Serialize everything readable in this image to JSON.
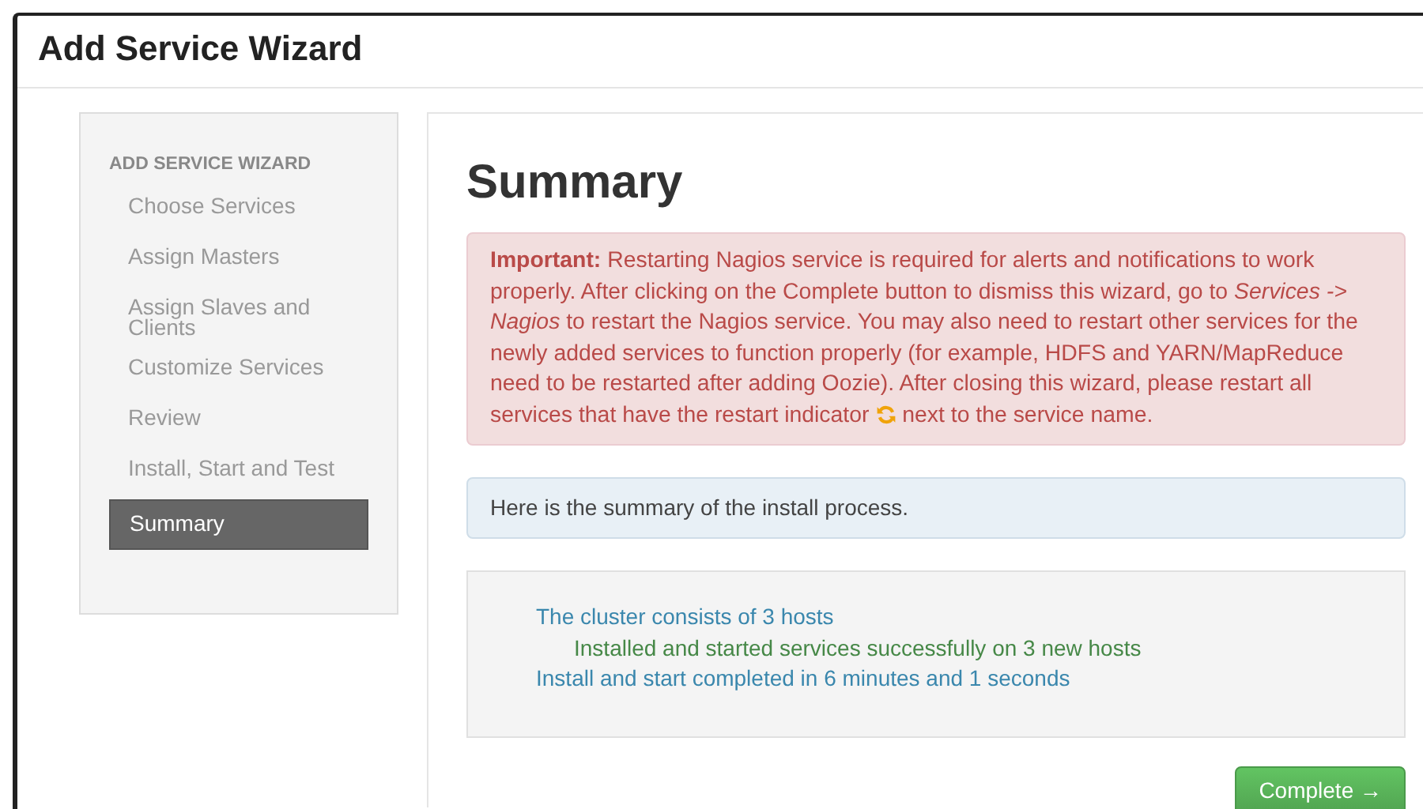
{
  "window": {
    "title": "Add Service Wizard"
  },
  "sidebar": {
    "heading": "ADD SERVICE WIZARD",
    "items": [
      {
        "label": "Choose Services",
        "selected": false
      },
      {
        "label": "Assign Masters",
        "selected": false
      },
      {
        "label": "Assign Slaves and Clients",
        "selected": false
      },
      {
        "label": "Customize Services",
        "selected": false
      },
      {
        "label": "Review",
        "selected": false
      },
      {
        "label": "Install, Start and Test",
        "selected": false
      },
      {
        "label": "Summary",
        "selected": true
      }
    ]
  },
  "main": {
    "title": "Summary",
    "alert": {
      "text_before": "**Important:** Restarting Nagios service is required for alerts and notifications to work properly. After clicking on the Complete button to dismiss this wizard, go to *Services -> Nagios* to restart the Nagios service. You may also need to restart other services for the newly added services to function properly (for example, HDFS and YARN/MapReduce need to be restarted after adding Oozie). After closing this wizard, please restart all services that have the restart indicator",
      "text_after": "next to the service name."
    },
    "info": "Here is the summary of the install process.",
    "summary_lines": [
      {
        "text": "The cluster consists of 3 hosts",
        "kind": "info",
        "children": [
          {
            "text": "Installed and started services successfully on 3 new hosts",
            "kind": "success"
          }
        ]
      },
      {
        "text": "Install and start completed in 6 minutes and 1 seconds",
        "kind": "info"
      }
    ],
    "button": "Complete →"
  }
}
